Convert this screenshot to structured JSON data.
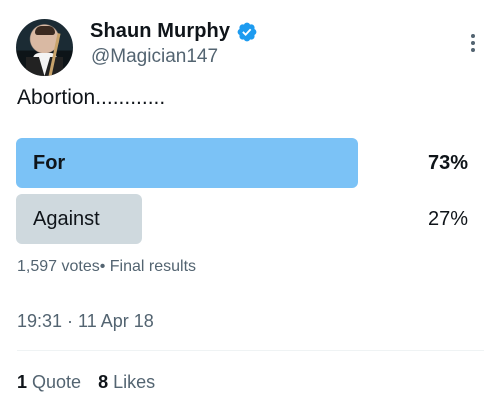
{
  "author": {
    "name": "Shaun Murphy",
    "handle": "@Magician147"
  },
  "tweet": {
    "text": "Abortion............"
  },
  "poll": {
    "options": [
      {
        "label": "For",
        "percent": 73,
        "percent_label": "73%"
      },
      {
        "label": "Against",
        "percent": 27,
        "percent_label": "27%"
      }
    ],
    "summary": "1,597 votes• Final results"
  },
  "timestamp": "19:31 · 11 Apr 18",
  "stats": {
    "quotes_count": "1",
    "quotes_label": "Quote",
    "likes_count": "8",
    "likes_label": "Likes"
  },
  "colors": {
    "winning_bar": "#7bc2f6",
    "losing_bar": "#cfd9de",
    "verified_badge": "#1d9bf0",
    "secondary_text": "#536471"
  }
}
